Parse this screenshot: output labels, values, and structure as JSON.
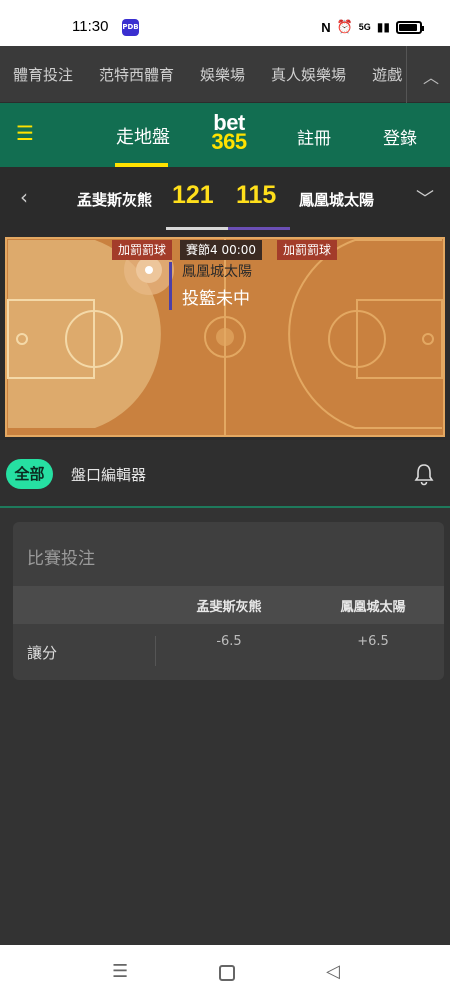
{
  "status_bar": {
    "time": "11:30",
    "app_icon_text": "PDB",
    "nfc_icon": "N",
    "network": "5G"
  },
  "category_nav": {
    "items": [
      "體育投注",
      "范特西體育",
      "娛樂場",
      "真人娛樂場",
      "遊戲"
    ],
    "collapse_icon": "chevron-up-icon"
  },
  "header": {
    "menu_icon": "hamburger-icon",
    "in_play": "走地盤",
    "logo_line1": "bet",
    "logo_line2": "365",
    "register": "註冊",
    "login": "登錄",
    "brand_green": "#126e51",
    "brand_yellow": "#ffe200"
  },
  "scoreboard": {
    "home_team": "孟斐斯灰熊",
    "home_score": "121",
    "away_score": "115",
    "away_team": "鳳凰城太陽",
    "score_color": "#ffdf1b"
  },
  "court": {
    "home_foul_tag": "加罰罰球",
    "period_tag": "賽節4  00:00",
    "away_foul_tag": "加罰罰球",
    "event_team": "鳳凰城太陽",
    "event_description": "投籃未中"
  },
  "market_tabs": {
    "all": "全部",
    "editor": "盤口編輯器",
    "accent": "#26e0a2"
  },
  "market_card": {
    "title": "比賽投注",
    "col_home": "孟斐斯灰熊",
    "col_away": "鳳凰城太陽",
    "row_label": "讓分",
    "home_line": "-6.5",
    "away_line": "+6.5"
  }
}
